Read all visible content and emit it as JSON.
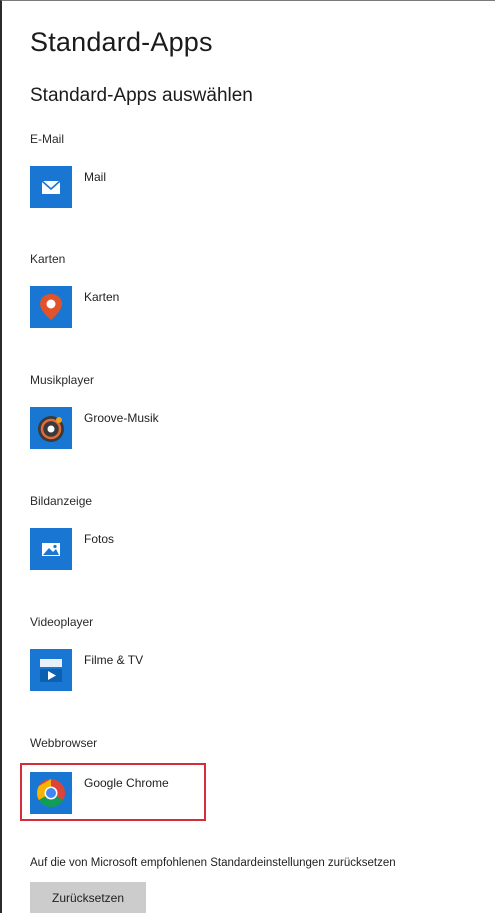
{
  "page": {
    "title": "Standard-Apps",
    "section_title": "Standard-Apps auswählen"
  },
  "categories": [
    {
      "label": "E-Mail",
      "app": "Mail",
      "icon": "mail-icon"
    },
    {
      "label": "Karten",
      "app": "Karten",
      "icon": "maps-pin-icon"
    },
    {
      "label": "Musikplayer",
      "app": "Groove-Musik",
      "icon": "groove-music-icon"
    },
    {
      "label": "Bildanzeige",
      "app": "Fotos",
      "icon": "photos-icon"
    },
    {
      "label": "Videoplayer",
      "app": "Filme & TV",
      "icon": "movies-tv-icon"
    },
    {
      "label": "Webbrowser",
      "app": "Google Chrome",
      "icon": "chrome-icon"
    }
  ],
  "reset": {
    "description": "Auf die von Microsoft empfohlenen Standardeinstellungen zurücksetzen",
    "button_label": "Zurücksetzen"
  },
  "colors": {
    "tile_blue": "#1976d2",
    "maps_orange": "#e0532b",
    "chrome_red": "#db4437",
    "chrome_yellow": "#f4b400",
    "chrome_green": "#0f9d58",
    "chrome_blue": "#4285f4",
    "highlight_red": "#d32f3a",
    "button_gray": "#cccccc"
  }
}
